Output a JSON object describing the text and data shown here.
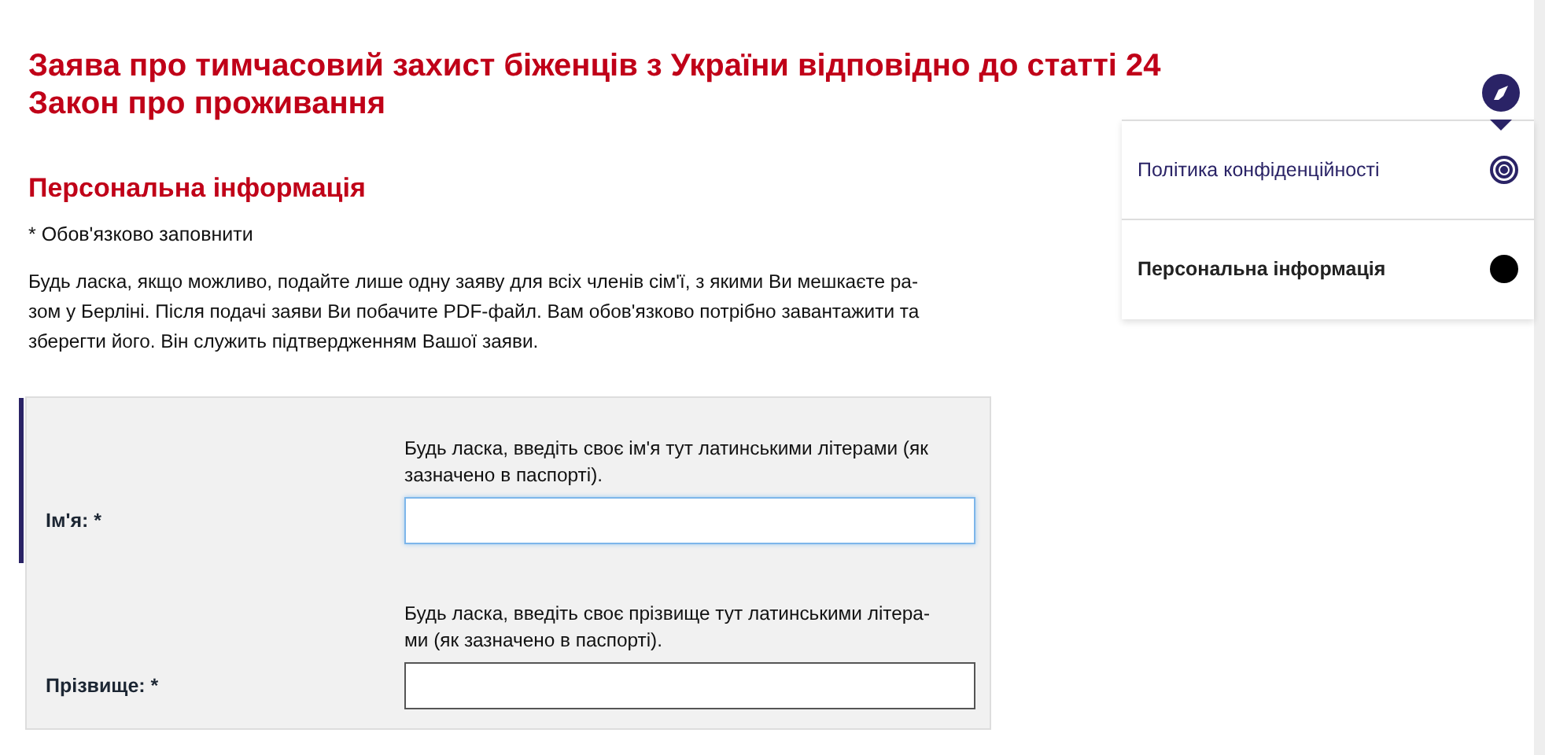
{
  "page": {
    "title": [
      "Заява про тимчасовий захист біженців з України відповідно до статті 24",
      "Закон про проживання"
    ]
  },
  "section": {
    "heading": "Персональна інформація",
    "required_note": "* Обов'язково заповнити",
    "intro": [
      "Будь ласка, якщо можливо, подайте лише одну заяву для всіх членів сім'ї, з якими Ви мешкаєте ра-",
      "зом у Берліні. Після подачі заяви Ви побачите PDF-файл. Вам обов'язково потрібно завантажити та",
      "зберегти його. Він служить підтвердженням Вашої заяви."
    ]
  },
  "fields": [
    {
      "label": "Ім'я: *",
      "hint": [
        "Будь ласка, введіть своє ім'я тут латинськими літерами (як",
        "зазначено в паспорті)."
      ],
      "focused": true
    },
    {
      "label": "Прізвище: *",
      "hint": [
        "Будь ласка, введіть своє прізвище тут латинськими літера-",
        "ми (як зазначено в паспорті)."
      ],
      "focused": false
    }
  ],
  "navigator": {
    "items": [
      {
        "label": "Політика конфіденційності",
        "selected": false
      },
      {
        "label": "Персональна інформація",
        "selected": true
      }
    ]
  }
}
